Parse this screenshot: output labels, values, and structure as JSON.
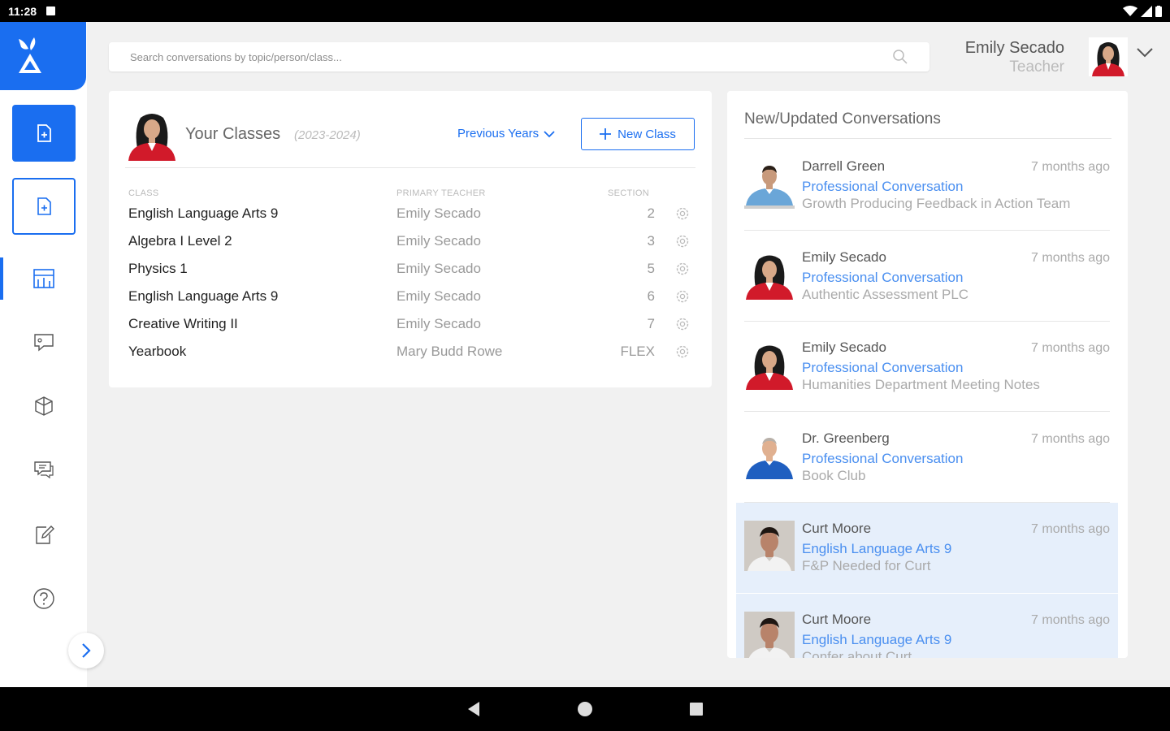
{
  "status": {
    "time": "11:28"
  },
  "search": {
    "placeholder": "Search conversations by topic/person/class..."
  },
  "user": {
    "name": "Emily Secado",
    "role": "Teacher"
  },
  "classes": {
    "title": "Your Classes",
    "year": "(2023-2024)",
    "previous_years_label": "Previous Years",
    "new_class_label": "New Class",
    "columns": {
      "class": "CLASS",
      "teacher": "PRIMARY TEACHER",
      "section": "SECTION"
    },
    "rows": [
      {
        "name": "English Language Arts 9",
        "teacher": "Emily Secado",
        "section": "2"
      },
      {
        "name": "Algebra I Level 2",
        "teacher": "Emily Secado",
        "section": "3"
      },
      {
        "name": "Physics 1",
        "teacher": "Emily Secado",
        "section": "5"
      },
      {
        "name": "English Language Arts 9",
        "teacher": "Emily Secado",
        "section": "6"
      },
      {
        "name": "Creative Writing II",
        "teacher": "Emily Secado",
        "section": "7"
      },
      {
        "name": "Yearbook",
        "teacher": "Mary Budd Rowe",
        "section": "FLEX"
      }
    ]
  },
  "conversations": {
    "title": "New/Updated Conversations",
    "items": [
      {
        "name": "Darrell Green",
        "time": "7 months ago",
        "type": "Professional Conversation",
        "topic": "Growth Producing Feedback in Action Team",
        "avatar": "man-shirt",
        "highlight": false
      },
      {
        "name": "Emily Secado",
        "time": "7 months ago",
        "type": "Professional Conversation",
        "topic": "Authentic Assessment PLC",
        "avatar": "woman",
        "highlight": false
      },
      {
        "name": "Emily Secado",
        "time": "7 months ago",
        "type": "Professional Conversation",
        "topic": "Humanities Department Meeting Notes",
        "avatar": "woman",
        "highlight": false
      },
      {
        "name": "Dr. Greenberg",
        "time": "7 months ago",
        "type": "Professional Conversation",
        "topic": "Book Club",
        "avatar": "man-blue",
        "highlight": false
      },
      {
        "name": "Curt Moore",
        "time": "7 months ago",
        "type": "English Language Arts 9",
        "topic": "F&P Needed for Curt",
        "avatar": "boy",
        "highlight": true
      },
      {
        "name": "Curt Moore",
        "time": "7 months ago",
        "type": "English Language Arts 9",
        "topic": "Confer about Curt",
        "avatar": "boy",
        "highlight": true
      }
    ]
  },
  "colors": {
    "accent": "#1a6ef0",
    "link": "#4a8ff0",
    "highlight": "#e6effb"
  }
}
